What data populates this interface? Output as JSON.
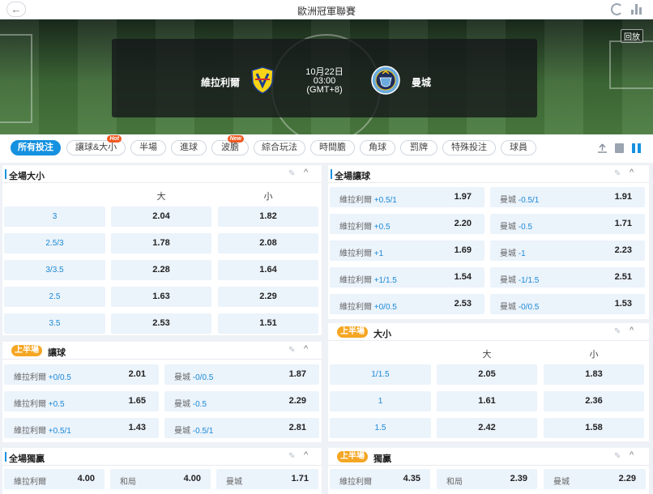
{
  "header": {
    "title": "歐洲冠軍聯賽",
    "back": "←"
  },
  "hero": {
    "video_label": "回放",
    "home_team": "維拉利爾",
    "away_team": "曼城",
    "date": "10月22日",
    "time": "03:00",
    "tz": "(GMT+8)"
  },
  "tabs": [
    {
      "label": "所有投注",
      "active": true
    },
    {
      "label": "讓球&大小",
      "hot": "Hot"
    },
    {
      "label": "半場"
    },
    {
      "label": "進球"
    },
    {
      "label": "波膽",
      "hot": "New"
    },
    {
      "label": "綜合玩法"
    },
    {
      "label": "時間膽"
    },
    {
      "label": "角球"
    },
    {
      "label": "罰牌"
    },
    {
      "label": "特殊投注"
    },
    {
      "label": "球員"
    }
  ],
  "ft_ou": {
    "title": "全場大小",
    "over": "大",
    "under": "小",
    "rows": [
      {
        "line": "3",
        "over": "2.04",
        "under": "1.82"
      },
      {
        "line": "2.5/3",
        "over": "1.78",
        "under": "2.08"
      },
      {
        "line": "3/3.5",
        "over": "2.28",
        "under": "1.64"
      },
      {
        "line": "2.5",
        "over": "1.63",
        "under": "2.29"
      },
      {
        "line": "3.5",
        "over": "2.53",
        "under": "1.51"
      }
    ]
  },
  "ft_hdp": {
    "title": "全場讓球",
    "rows": [
      {
        "home": "維拉利爾",
        "home_line": "+0.5/1",
        "home_odd": "1.97",
        "away": "曼城",
        "away_line": "-0.5/1",
        "away_odd": "1.91"
      },
      {
        "home": "維拉利爾",
        "home_line": "+0.5",
        "home_odd": "2.20",
        "away": "曼城",
        "away_line": "-0.5",
        "away_odd": "1.71"
      },
      {
        "home": "維拉利爾",
        "home_line": "+1",
        "home_odd": "1.69",
        "away": "曼城",
        "away_line": "-1",
        "away_odd": "2.23"
      },
      {
        "home": "維拉利爾",
        "home_line": "+1/1.5",
        "home_odd": "1.54",
        "away": "曼城",
        "away_line": "-1/1.5",
        "away_odd": "2.51"
      },
      {
        "home": "維拉利爾",
        "home_line": "+0/0.5",
        "home_odd": "2.53",
        "away": "曼城",
        "away_line": "-0/0.5",
        "away_odd": "1.53"
      }
    ]
  },
  "fh_hdp": {
    "badge": "上半場",
    "title": "讓球",
    "rows": [
      {
        "home": "維拉利爾",
        "home_line": "+0/0.5",
        "home_odd": "2.01",
        "away": "曼城",
        "away_line": "-0/0.5",
        "away_odd": "1.87"
      },
      {
        "home": "維拉利爾",
        "home_line": "+0.5",
        "home_odd": "1.65",
        "away": "曼城",
        "away_line": "-0.5",
        "away_odd": "2.29"
      },
      {
        "home": "維拉利爾",
        "home_line": "+0.5/1",
        "home_odd": "1.43",
        "away": "曼城",
        "away_line": "-0.5/1",
        "away_odd": "2.81"
      }
    ]
  },
  "fh_ou": {
    "badge": "上半場",
    "title": "大小",
    "over": "大",
    "under": "小",
    "rows": [
      {
        "line": "1/1.5",
        "over": "2.05",
        "under": "1.83"
      },
      {
        "line": "1",
        "over": "1.61",
        "under": "2.36"
      },
      {
        "line": "1.5",
        "over": "2.42",
        "under": "1.58"
      }
    ]
  },
  "ft_1x2": {
    "title": "全場獨贏",
    "home": "維拉利爾",
    "home_odd": "4.00",
    "draw": "和局",
    "draw_odd": "4.00",
    "away": "曼城",
    "away_odd": "1.71"
  },
  "fh_1x2": {
    "badge": "上半場",
    "title": "獨贏",
    "home": "維拉利爾",
    "home_odd": "4.35",
    "draw": "和局",
    "draw_odd": "2.39",
    "away": "曼城",
    "away_odd": "2.29"
  },
  "colors": {
    "accent": "#1591e0",
    "badge": "#f5a623",
    "hot": "#f05a23"
  }
}
